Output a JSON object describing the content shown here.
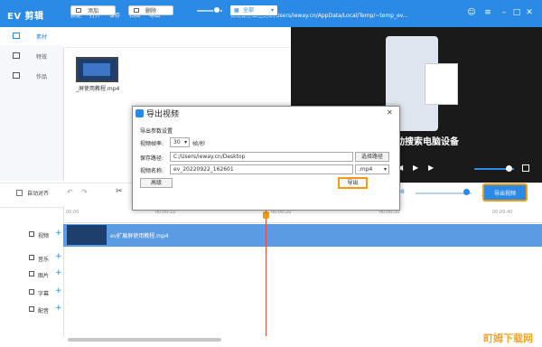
{
  "app": {
    "logo": "EV 剪辑",
    "menu": [
      "新建",
      "打开",
      "保存",
      "归档",
      "导出"
    ],
    "title_path": "自动保存工程到C:/Users/ieway.cn/AppData/Local/Temp/~temp_ev..."
  },
  "sidebar": {
    "items": [
      {
        "label": "素材"
      },
      {
        "label": "特效"
      },
      {
        "label": "作品"
      }
    ]
  },
  "media": {
    "add_label": "添加",
    "delete_label": "删除",
    "filter_value": "全部",
    "file_name": "_屏使用教程.mp4"
  },
  "preview": {
    "subtitle": "动搜索电脑设备"
  },
  "toolbar": {
    "auto_align_label": "自动对齐",
    "timecode": "08",
    "export_video_label": "导出视频"
  },
  "timeline": {
    "ticks": [
      "00:00",
      "00:00:10",
      "00:00:20",
      "00:00:30",
      "00:00:40"
    ],
    "tracks": [
      {
        "label": "视频"
      },
      {
        "label": "音乐"
      },
      {
        "label": "图片"
      },
      {
        "label": "字幕"
      },
      {
        "label": "配音"
      }
    ],
    "clip_label": "ev扩展屏使用教程.mp4"
  },
  "dialog": {
    "title": "导出视频",
    "section": "导出参数设置",
    "fps_label": "视频帧率:",
    "fps_value": "30",
    "fps_unit": "帧/秒",
    "path_label": "保存路径:",
    "path_value": "C:/Users/ieway.cn/Desktop",
    "choose_path_label": "选择路径",
    "name_label": "视频名称:",
    "name_value": "ev_20220922_162601",
    "format_value": ".mp4",
    "advanced_label": "高级",
    "export_label": "导出"
  },
  "watermark": "町姆下载网",
  "colors": {
    "accent": "#2b8ae6",
    "highlight": "#f39c12"
  }
}
